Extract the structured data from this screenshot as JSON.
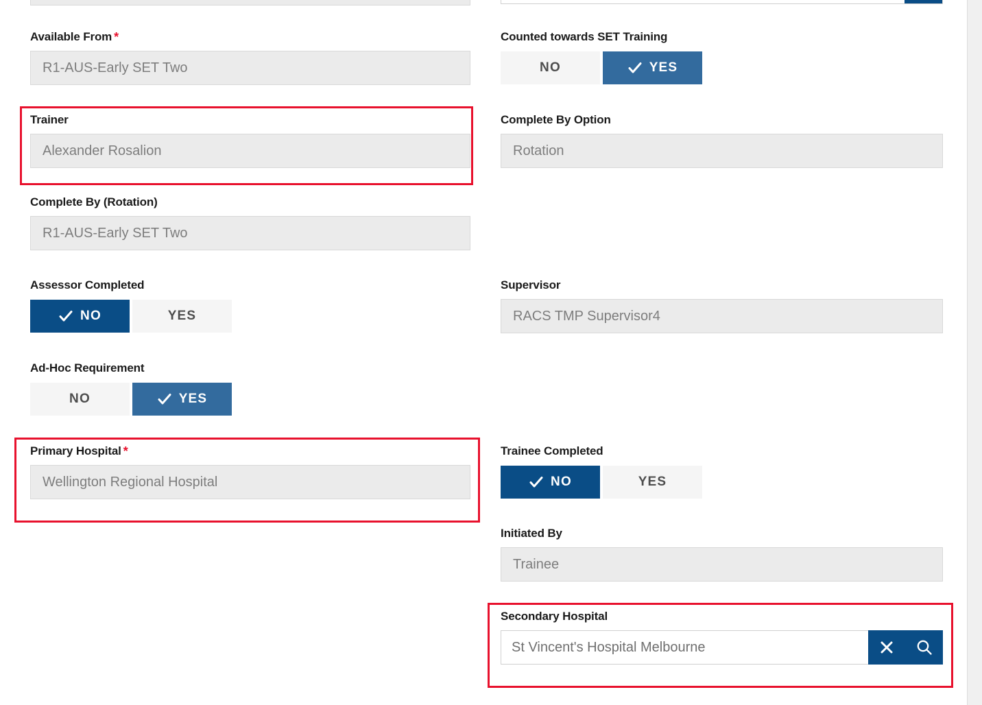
{
  "theme": {
    "navy": "#0a4d86",
    "blue": "#336b9e",
    "highlight_red": "#e8112d",
    "required_star": "*",
    "disabled_bg": "#ebebeb",
    "toggle_off_bg": "#f5f5f5"
  },
  "left_column": {
    "available_from": {
      "label": "Available From",
      "required": true,
      "value": "R1-AUS-Early SET Two",
      "state": "disabled"
    },
    "trainer": {
      "label": "Trainer",
      "required": false,
      "value": "Alexander Rosalion",
      "state": "disabled",
      "highlighted": true
    },
    "complete_by_rotation": {
      "label": "Complete By (Rotation)",
      "required": false,
      "value": "R1-AUS-Early SET Two",
      "state": "disabled"
    },
    "assessor_completed": {
      "label": "Assessor Completed",
      "options": [
        "NO",
        "YES"
      ],
      "selected": "NO",
      "selected_style": "navy"
    },
    "ad_hoc_requirement": {
      "label": "Ad-Hoc Requirement",
      "options": [
        "NO",
        "YES"
      ],
      "selected": "YES",
      "selected_style": "blue"
    },
    "primary_hospital": {
      "label": "Primary Hospital",
      "required": true,
      "value": "Wellington Regional Hospital",
      "state": "disabled",
      "highlighted": true
    }
  },
  "right_column": {
    "counted_towards_set_training": {
      "label": "Counted towards SET Training",
      "options": [
        "NO",
        "YES"
      ],
      "selected": "YES",
      "selected_style": "blue"
    },
    "complete_by_option": {
      "label": "Complete By Option",
      "required": false,
      "value": "Rotation",
      "state": "disabled"
    },
    "supervisor": {
      "label": "Supervisor",
      "required": false,
      "value": "RACS TMP Supervisor4",
      "state": "disabled"
    },
    "trainee_completed": {
      "label": "Trainee Completed",
      "options": [
        "NO",
        "YES"
      ],
      "selected": "NO",
      "selected_style": "navy"
    },
    "initiated_by": {
      "label": "Initiated By",
      "required": false,
      "value": "Trainee",
      "state": "disabled"
    },
    "secondary_hospital": {
      "label": "Secondary Hospital",
      "required": false,
      "value": "St Vincent's Hospital Melbourne",
      "state": "editable",
      "highlighted": true,
      "clear_icon": "close-icon",
      "search_icon": "search-icon"
    }
  }
}
